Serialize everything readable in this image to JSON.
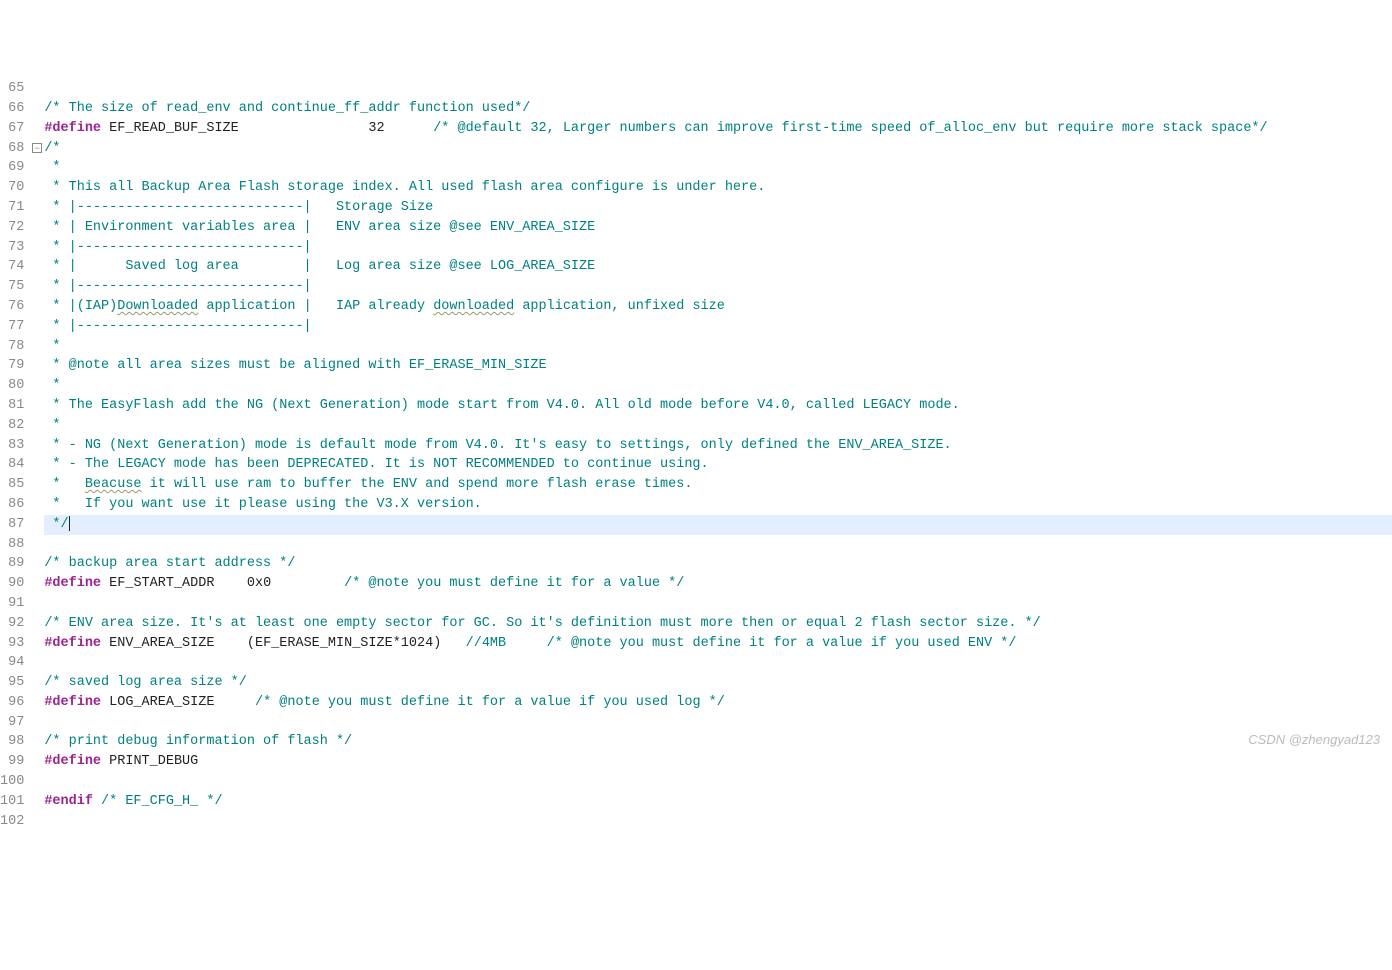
{
  "watermark": "CSDN @zhengyad123",
  "lines": [
    {
      "n": 65,
      "fold": "",
      "hl": false,
      "segs": []
    },
    {
      "n": 66,
      "fold": "",
      "hl": false,
      "segs": [
        {
          "cls": "comment",
          "t": "/* The size of read_env and continue_ff_addr function used*/"
        }
      ]
    },
    {
      "n": 67,
      "fold": "",
      "hl": false,
      "segs": [
        {
          "cls": "preproc",
          "t": "#define"
        },
        {
          "cls": "plain",
          "t": " "
        },
        {
          "cls": "ident",
          "t": "EF_READ_BUF_SIZE"
        },
        {
          "cls": "plain",
          "t": "                32      "
        },
        {
          "cls": "comment",
          "t": "/* @default 32, Larger numbers can improve first-time speed of_alloc_env but require more stack space*/"
        }
      ]
    },
    {
      "n": 68,
      "fold": "minus",
      "hl": false,
      "segs": [
        {
          "cls": "comment",
          "t": "/*"
        }
      ]
    },
    {
      "n": 69,
      "fold": "",
      "hl": false,
      "segs": [
        {
          "cls": "comment",
          "t": " *"
        }
      ]
    },
    {
      "n": 70,
      "fold": "",
      "hl": false,
      "segs": [
        {
          "cls": "comment",
          "t": " * This all Backup Area Flash storage index. All used flash area configure is under here."
        }
      ]
    },
    {
      "n": 71,
      "fold": "",
      "hl": false,
      "segs": [
        {
          "cls": "comment",
          "t": " * |----------------------------|   Storage Size"
        }
      ]
    },
    {
      "n": 72,
      "fold": "",
      "hl": false,
      "segs": [
        {
          "cls": "comment",
          "t": " * | Environment variables area |   ENV area size @see ENV_AREA_SIZE"
        }
      ]
    },
    {
      "n": 73,
      "fold": "",
      "hl": false,
      "segs": [
        {
          "cls": "comment",
          "t": " * |----------------------------|"
        }
      ]
    },
    {
      "n": 74,
      "fold": "",
      "hl": false,
      "segs": [
        {
          "cls": "comment",
          "t": " * |      Saved log area        |   Log area size @see LOG_AREA_SIZE"
        }
      ]
    },
    {
      "n": 75,
      "fold": "",
      "hl": false,
      "segs": [
        {
          "cls": "comment",
          "t": " * |----------------------------|"
        }
      ]
    },
    {
      "n": 76,
      "fold": "",
      "hl": false,
      "segs": [
        {
          "cls": "comment",
          "t": " * |(IAP)"
        },
        {
          "cls": "comment waved",
          "t": "Downloaded"
        },
        {
          "cls": "comment",
          "t": " application |   IAP already "
        },
        {
          "cls": "comment waved",
          "t": "downloaded"
        },
        {
          "cls": "comment",
          "t": " application, unfixed size"
        }
      ]
    },
    {
      "n": 77,
      "fold": "",
      "hl": false,
      "segs": [
        {
          "cls": "comment",
          "t": " * |----------------------------|"
        }
      ]
    },
    {
      "n": 78,
      "fold": "",
      "hl": false,
      "segs": [
        {
          "cls": "comment",
          "t": " *"
        }
      ]
    },
    {
      "n": 79,
      "fold": "",
      "hl": false,
      "segs": [
        {
          "cls": "comment",
          "t": " * @note all area sizes must be aligned with EF_ERASE_MIN_SIZE"
        }
      ]
    },
    {
      "n": 80,
      "fold": "",
      "hl": false,
      "segs": [
        {
          "cls": "comment",
          "t": " *"
        }
      ]
    },
    {
      "n": 81,
      "fold": "",
      "hl": false,
      "segs": [
        {
          "cls": "comment",
          "t": " * The EasyFlash add the NG (Next Generation) mode start from V4.0. All old mode before V4.0, called LEGACY mode."
        }
      ]
    },
    {
      "n": 82,
      "fold": "",
      "hl": false,
      "segs": [
        {
          "cls": "comment",
          "t": " *"
        }
      ]
    },
    {
      "n": 83,
      "fold": "",
      "hl": false,
      "segs": [
        {
          "cls": "comment",
          "t": " * - NG (Next Generation) mode is default mode from V4.0. It's easy to settings, only defined the ENV_AREA_SIZE."
        }
      ]
    },
    {
      "n": 84,
      "fold": "",
      "hl": false,
      "segs": [
        {
          "cls": "comment",
          "t": " * - The LEGACY mode has been DEPRECATED. It is NOT RECOMMENDED to continue using."
        }
      ]
    },
    {
      "n": 85,
      "fold": "",
      "hl": false,
      "segs": [
        {
          "cls": "comment",
          "t": " *   "
        },
        {
          "cls": "comment waved",
          "t": "Beacuse"
        },
        {
          "cls": "comment",
          "t": " it will use ram to buffer the ENV and spend more flash erase times."
        }
      ]
    },
    {
      "n": 86,
      "fold": "",
      "hl": false,
      "segs": [
        {
          "cls": "comment",
          "t": " *   If you want use it please using the V3.X version."
        }
      ]
    },
    {
      "n": 87,
      "fold": "",
      "hl": true,
      "segs": [
        {
          "cls": "comment",
          "t": " */"
        },
        {
          "cls": "cursor",
          "t": ""
        }
      ]
    },
    {
      "n": 88,
      "fold": "",
      "hl": false,
      "segs": []
    },
    {
      "n": 89,
      "fold": "",
      "hl": false,
      "segs": [
        {
          "cls": "comment",
          "t": "/* backup area start address */"
        }
      ]
    },
    {
      "n": 90,
      "fold": "",
      "hl": false,
      "segs": [
        {
          "cls": "preproc",
          "t": "#define"
        },
        {
          "cls": "plain",
          "t": " "
        },
        {
          "cls": "ident",
          "t": "EF_START_ADDR"
        },
        {
          "cls": "plain",
          "t": "    0x0         "
        },
        {
          "cls": "comment",
          "t": "/* @note you must define it for a value */"
        }
      ]
    },
    {
      "n": 91,
      "fold": "",
      "hl": false,
      "segs": []
    },
    {
      "n": 92,
      "fold": "",
      "hl": false,
      "segs": [
        {
          "cls": "comment",
          "t": "/* ENV area size. It's at least one empty sector for GC. So it's definition must more then or equal 2 flash sector size. */"
        }
      ]
    },
    {
      "n": 93,
      "fold": "",
      "hl": false,
      "segs": [
        {
          "cls": "preproc",
          "t": "#define"
        },
        {
          "cls": "plain",
          "t": " "
        },
        {
          "cls": "ident",
          "t": "ENV_AREA_SIZE"
        },
        {
          "cls": "plain",
          "t": "    (EF_ERASE_MIN_SIZE*1024)   "
        },
        {
          "cls": "comment",
          "t": "//4MB     /* @note you must define it for a value if you used ENV */"
        }
      ]
    },
    {
      "n": 94,
      "fold": "",
      "hl": false,
      "segs": []
    },
    {
      "n": 95,
      "fold": "",
      "hl": false,
      "segs": [
        {
          "cls": "comment",
          "t": "/* saved log area size */"
        }
      ]
    },
    {
      "n": 96,
      "fold": "",
      "hl": false,
      "segs": [
        {
          "cls": "preproc",
          "t": "#define"
        },
        {
          "cls": "plain",
          "t": " "
        },
        {
          "cls": "ident",
          "t": "LOG_AREA_SIZE"
        },
        {
          "cls": "plain",
          "t": "     "
        },
        {
          "cls": "comment",
          "t": "/* @note you must define it for a value if you used log */"
        }
      ]
    },
    {
      "n": 97,
      "fold": "",
      "hl": false,
      "segs": []
    },
    {
      "n": 98,
      "fold": "",
      "hl": false,
      "segs": [
        {
          "cls": "comment",
          "t": "/* print debug information of flash */"
        }
      ]
    },
    {
      "n": 99,
      "fold": "",
      "hl": false,
      "segs": [
        {
          "cls": "preproc",
          "t": "#define"
        },
        {
          "cls": "plain",
          "t": " "
        },
        {
          "cls": "ident",
          "t": "PRINT_DEBUG"
        }
      ]
    },
    {
      "n": 100,
      "fold": "",
      "hl": false,
      "segs": []
    },
    {
      "n": 101,
      "fold": "",
      "hl": false,
      "segs": [
        {
          "cls": "preproc",
          "t": "#endif"
        },
        {
          "cls": "plain",
          "t": " "
        },
        {
          "cls": "comment",
          "t": "/* EF_CFG_H_ */"
        }
      ]
    },
    {
      "n": 102,
      "fold": "",
      "hl": false,
      "segs": []
    }
  ]
}
